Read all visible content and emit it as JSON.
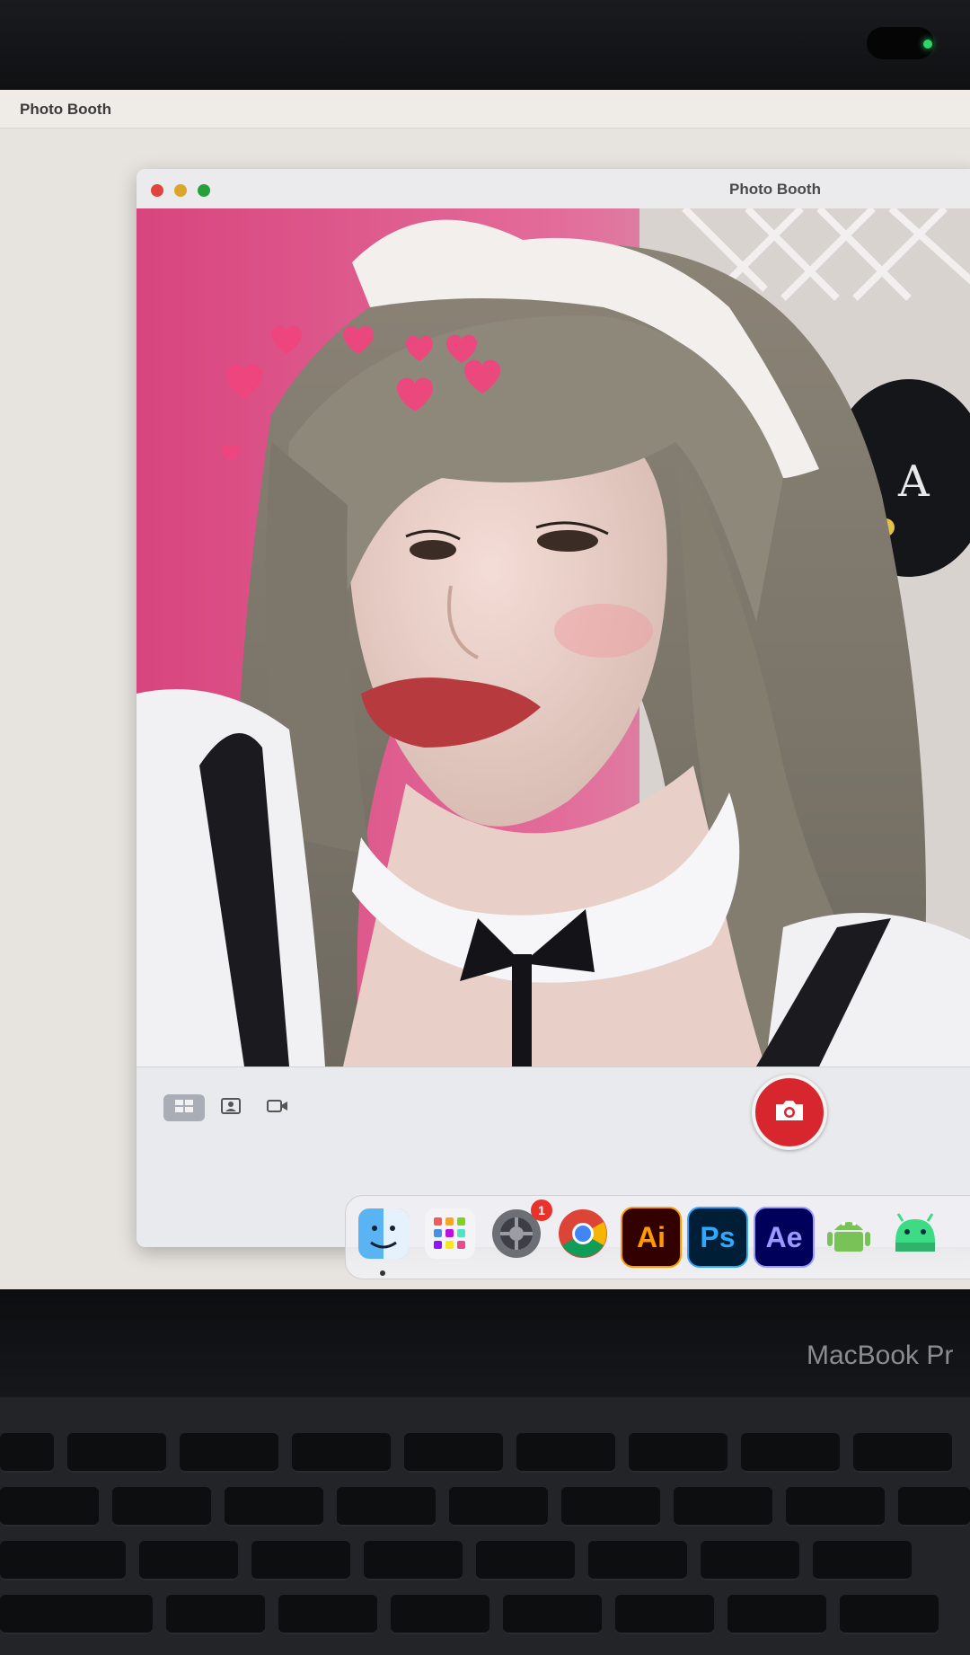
{
  "menubar": {
    "app_name": "Photo Booth"
  },
  "window": {
    "title": "Photo Booth"
  },
  "toolbar": {
    "modes": [
      {
        "name": "grid-view",
        "icon": "grid-icon",
        "active": true
      },
      {
        "name": "single-photo",
        "icon": "portrait-icon",
        "active": false
      },
      {
        "name": "video",
        "icon": "video-camera-icon",
        "active": false
      }
    ],
    "shutter_icon": "camera-icon",
    "shutter_color": "#d7262d"
  },
  "dock": {
    "apps": [
      {
        "name": "Finder",
        "icon": "finder-icon"
      },
      {
        "name": "Launchpad",
        "icon": "launchpad-icon"
      },
      {
        "name": "System Settings",
        "icon": "settings-icon",
        "badge": "1"
      },
      {
        "name": "Chrome",
        "icon": "chrome-icon"
      },
      {
        "name": "Illustrator",
        "icon": "illustrator-icon",
        "label": "Ai"
      },
      {
        "name": "Photoshop",
        "icon": "photoshop-icon",
        "label": "Ps"
      },
      {
        "name": "After Effects",
        "icon": "after-effects-icon",
        "label": "Ae"
      },
      {
        "name": "Android File Transfer",
        "icon": "android-icon"
      },
      {
        "name": "Android Studio",
        "icon": "android-studio-icon"
      }
    ]
  },
  "laptop": {
    "brand": "MacBook Pr"
  }
}
